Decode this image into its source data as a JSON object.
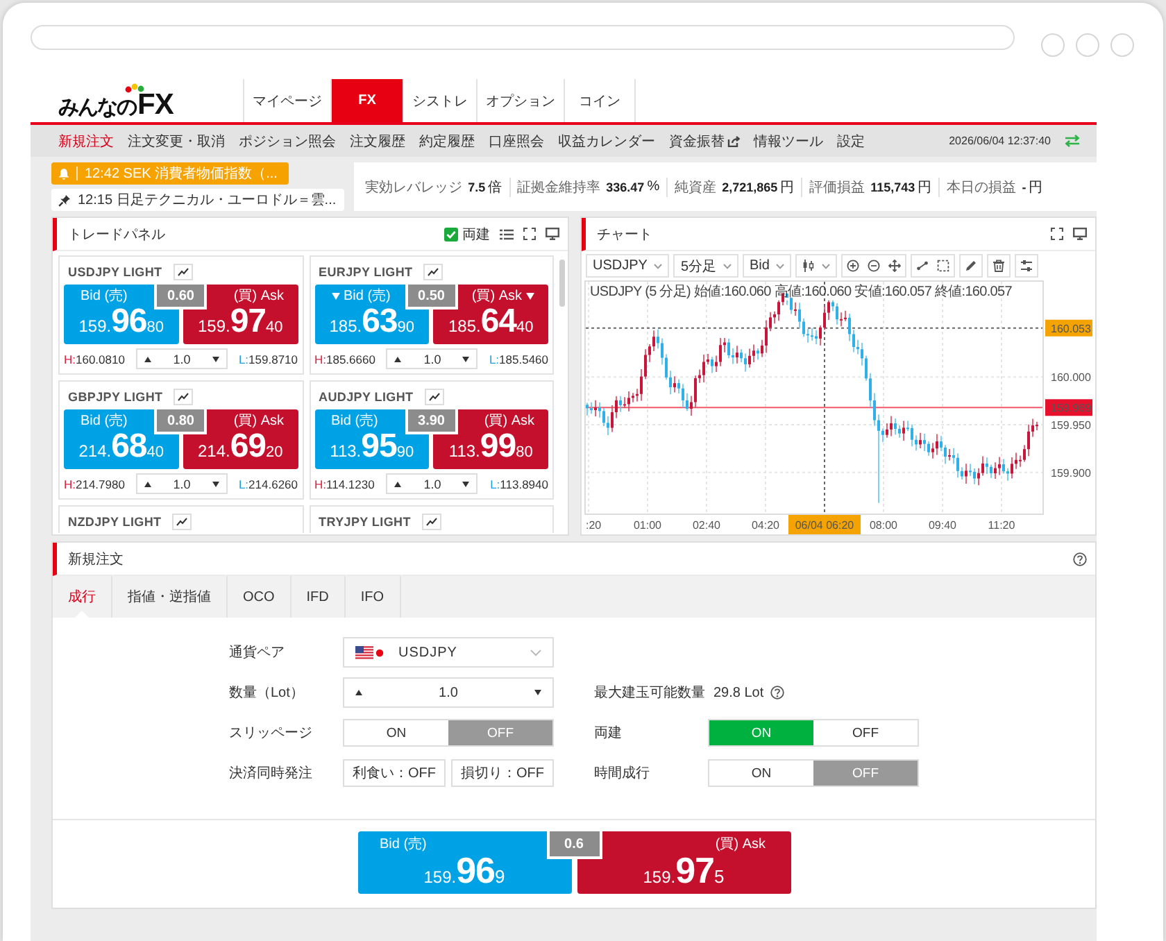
{
  "header": {
    "logo": {
      "text": "みんなの",
      "accent": "FX"
    },
    "tabs": [
      {
        "label": "マイページ",
        "selected": false
      },
      {
        "label": "FX",
        "selected": true
      },
      {
        "label": "シストレ",
        "selected": false
      },
      {
        "label": "オプション",
        "selected": false
      },
      {
        "label": "コイン",
        "selected": false
      }
    ]
  },
  "subnav": {
    "items": [
      {
        "label": "新規注文",
        "selected": true,
        "external": false
      },
      {
        "label": "注文変更・取消",
        "selected": false,
        "external": false
      },
      {
        "label": "ポジション照会",
        "selected": false,
        "external": false
      },
      {
        "label": "注文履歴",
        "selected": false,
        "external": false
      },
      {
        "label": "約定履歴",
        "selected": false,
        "external": false
      },
      {
        "label": "口座照会",
        "selected": false,
        "external": false
      },
      {
        "label": "収益カレンダー",
        "selected": false,
        "external": false
      },
      {
        "label": "資金振替",
        "selected": false,
        "external": true
      },
      {
        "label": "情報ツール",
        "selected": false,
        "external": false
      },
      {
        "label": "設定",
        "selected": false,
        "external": false
      }
    ],
    "datetime": "2026/06/04 12:37:40"
  },
  "ticker": {
    "alert": "12:42 SEK 消費者物価指数（...",
    "news": "12:15 日足テクニカル・ユーロドル＝雲..."
  },
  "account_stats": [
    {
      "label": "実効レバレッジ",
      "value": "7.5",
      "unit": "倍"
    },
    {
      "label": "証拠金維持率",
      "value": "336.47",
      "unit": "%"
    },
    {
      "label": "純資産",
      "value": "2,721,865",
      "unit": "円"
    },
    {
      "label": "評価損益",
      "value": "115,743",
      "unit": "円"
    },
    {
      "label": "本日の損益",
      "value": "-",
      "unit": "円"
    }
  ],
  "trade_panel": {
    "title": "トレードパネル",
    "hedge": {
      "label": "両建",
      "checked": true
    },
    "tiles": [
      {
        "pair": "USDJPY LIGHT",
        "bid": {
          "label": "Bid (売)",
          "head": "159.",
          "big": "96",
          "tail": "80",
          "falling": false
        },
        "spread": "0.60",
        "ask": {
          "label": "(買) Ask",
          "head": "159.",
          "big": "97",
          "tail": "40",
          "falling": false
        },
        "high_prefix": "H:",
        "high": "160.0810",
        "lot": "1.0",
        "low_prefix": "L:",
        "low": "159.8710"
      },
      {
        "pair": "EURJPY LIGHT",
        "bid": {
          "label": "Bid (売)",
          "head": "185.",
          "big": "63",
          "tail": "90",
          "falling": true
        },
        "spread": "0.50",
        "ask": {
          "label": "(買) Ask",
          "head": "185.",
          "big": "64",
          "tail": "40",
          "falling": true
        },
        "high_prefix": "H:",
        "high": "185.6660",
        "lot": "1.0",
        "low_prefix": "L:",
        "low": "185.5460"
      },
      {
        "pair": "GBPJPY LIGHT",
        "bid": {
          "label": "Bid (売)",
          "head": "214.",
          "big": "68",
          "tail": "40",
          "falling": false
        },
        "spread": "0.80",
        "ask": {
          "label": "(買) Ask",
          "head": "214.",
          "big": "69",
          "tail": "20",
          "falling": false
        },
        "high_prefix": "H:",
        "high": "214.7980",
        "lot": "1.0",
        "low_prefix": "L:",
        "low": "214.6260"
      },
      {
        "pair": "AUDJPY LIGHT",
        "bid": {
          "label": "Bid (売)",
          "head": "113.",
          "big": "95",
          "tail": "90",
          "falling": false
        },
        "spread": "3.90",
        "ask": {
          "label": "(買) Ask",
          "head": "113.",
          "big": "99",
          "tail": "80",
          "falling": false
        },
        "high_prefix": "H:",
        "high": "114.1230",
        "lot": "1.0",
        "low_prefix": "L:",
        "low": "113.8940"
      },
      {
        "pair": "NZDJPY LIGHT"
      },
      {
        "pair": "TRYJPY LIGHT"
      }
    ]
  },
  "chart": {
    "title": "チャート",
    "toolbar": [
      {
        "label": "USDJPY"
      },
      {
        "label": "5分足"
      },
      {
        "label": "Bid"
      }
    ],
    "info": "USDJPY (5 分足) 始値:160.060 高値:160.060 安値:160.057 終値:160.057",
    "y_labels": [
      "160.000",
      "159.950",
      "159.900"
    ],
    "price_tags": [
      {
        "kind": "cursor",
        "text": "160.053"
      },
      {
        "kind": "last",
        "text": "159.969"
      }
    ],
    "x_labels": [
      {
        "kind": "tick",
        "text": ":20"
      },
      {
        "kind": "tick",
        "text": "01:00"
      },
      {
        "kind": "tick",
        "text": "02:40"
      },
      {
        "kind": "tick",
        "text": "04:20"
      },
      {
        "kind": "cursor",
        "text": "06/04 06:20"
      },
      {
        "kind": "tick",
        "text": "08:00"
      },
      {
        "kind": "tick",
        "text": "09:40"
      },
      {
        "kind": "tick",
        "text": "11:20"
      }
    ]
  },
  "order_panel": {
    "title": "新規注文",
    "tabs": [
      {
        "label": "成行",
        "selected": true
      },
      {
        "label": "指値・逆指値",
        "selected": false
      },
      {
        "label": "OCO",
        "selected": false
      },
      {
        "label": "IFD",
        "selected": false
      },
      {
        "label": "IFO",
        "selected": false
      }
    ],
    "rows": [
      {
        "fields": [
          {
            "kind": "select",
            "label": "通貨ペア",
            "value": "USDJPY"
          }
        ]
      },
      {
        "fields": [
          {
            "kind": "stepper",
            "label": "数量（Lot）",
            "value": "1.0"
          },
          {
            "kind": "info",
            "label": "最大建玉可能数量",
            "value": "29.8 Lot"
          }
        ]
      },
      {
        "fields": [
          {
            "kind": "toggle",
            "label": "スリッページ",
            "options": [
              {
                "label": "ON",
                "selected": false
              },
              {
                "label": "OFF",
                "selected": true
              }
            ]
          },
          {
            "kind": "toggle",
            "label": "両建",
            "options": [
              {
                "label": "ON",
                "selected": true
              },
              {
                "label": "OFF",
                "selected": false
              }
            ]
          }
        ]
      },
      {
        "fields": [
          {
            "kind": "buttons",
            "label": "決済同時発注",
            "buttons": [
              "利食い：OFF",
              "損切り：OFF"
            ]
          },
          {
            "kind": "toggle",
            "label": "時間成行",
            "options": [
              {
                "label": "ON",
                "selected": false
              },
              {
                "label": "OFF",
                "selected": true
              }
            ]
          }
        ]
      }
    ],
    "quote": {
      "bid": {
        "label": "Bid (売)",
        "head": "159.",
        "big": "96",
        "tail": "9"
      },
      "spread": "0.6",
      "ask": {
        "label": "(買) Ask",
        "head": "159.",
        "big": "97",
        "tail": "5"
      }
    }
  }
}
